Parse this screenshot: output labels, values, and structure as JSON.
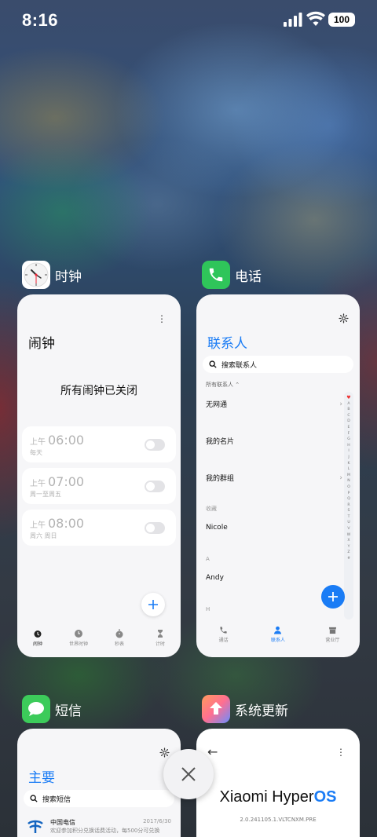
{
  "status": {
    "time": "8:16",
    "battery": "100"
  },
  "apps": {
    "clock": {
      "name": "时钟"
    },
    "phone": {
      "name": "电话"
    },
    "messages": {
      "name": "短信"
    },
    "update": {
      "name": "系统更新"
    }
  },
  "clock_card": {
    "title": "闹钟",
    "all_off": "所有闹钟已关闭",
    "alarms": [
      {
        "ampm": "上午",
        "time": "06:00",
        "repeat": "每天",
        "enabled": false
      },
      {
        "ampm": "上午",
        "time": "07:00",
        "repeat": "周一至周五",
        "enabled": false
      },
      {
        "ampm": "上午",
        "time": "08:00",
        "repeat": "周六 周日",
        "enabled": false
      }
    ],
    "tabs": [
      "闹钟",
      "世界时钟",
      "秒表",
      "计时"
    ]
  },
  "phone_card": {
    "title": "联系人",
    "search_placeholder": "搜索联系人",
    "filter": "所有联系人",
    "rows": [
      "无网通",
      "我的名片",
      "我的群组"
    ],
    "favorites_label": "收藏",
    "favorite": "Nicole",
    "section_a": "A",
    "contact_a": "Andy",
    "section_h": "H",
    "index": [
      "A",
      "B",
      "C",
      "D",
      "E",
      "F",
      "G",
      "H",
      "I",
      "J",
      "K",
      "L",
      "M",
      "N",
      "O",
      "P",
      "Q",
      "R",
      "S",
      "T",
      "U",
      "V",
      "W",
      "X",
      "Y",
      "Z",
      "#"
    ],
    "tabs": [
      "通话",
      "联系人",
      "营业厅"
    ]
  },
  "messages_card": {
    "title": "主要",
    "search_placeholder": "搜索短信",
    "thread": {
      "sender": "中国电信",
      "date": "2017/6/30",
      "preview": "欢迎参加积分兑换话费活动，每500分可兑换"
    }
  },
  "update_card": {
    "brand_a": "Xiaomi Hyper",
    "brand_b": "OS",
    "version": "2.0.241105.1.VLTCNXM.PRE"
  },
  "colors": {
    "accent": "#1a7cf5",
    "phone_green": "#2fc55a",
    "messages_green": "#3ccb5a"
  }
}
